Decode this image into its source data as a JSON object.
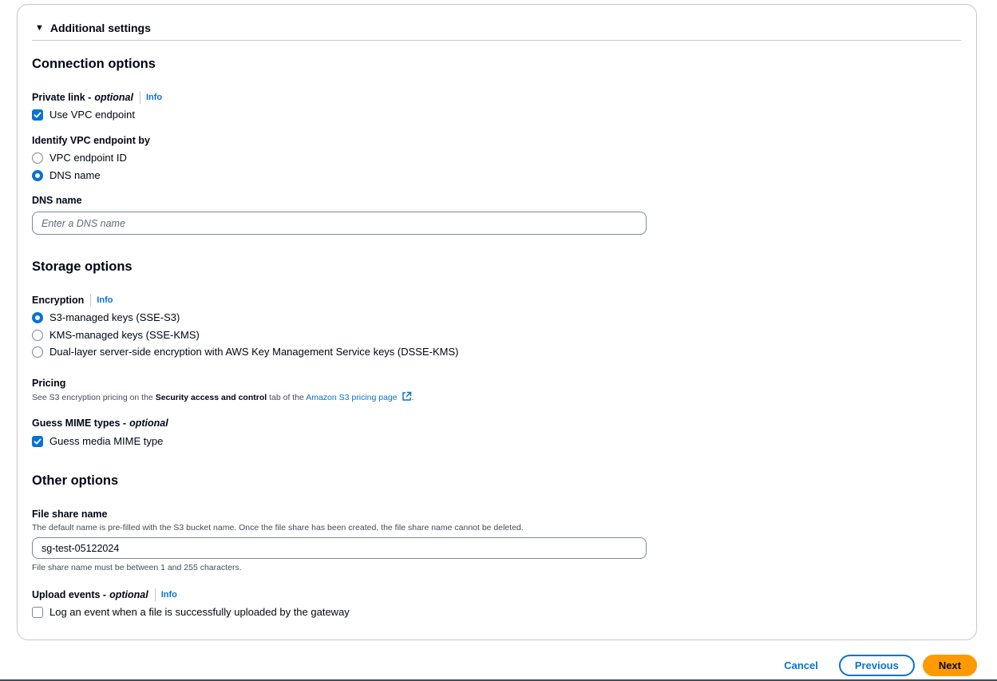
{
  "section": {
    "title": "Additional settings"
  },
  "connection": {
    "heading": "Connection options",
    "private_link_label": "Private link -",
    "private_link_optional": "optional",
    "private_link_info": "Info",
    "use_vpc_label": "Use VPC endpoint",
    "use_vpc_checked": true,
    "identify_label": "Identify VPC endpoint by",
    "identify_options": [
      {
        "label": "VPC endpoint ID",
        "selected": false
      },
      {
        "label": "DNS name",
        "selected": true
      }
    ],
    "dns_label": "DNS name",
    "dns_placeholder": "Enter a DNS name",
    "dns_value": ""
  },
  "storage": {
    "heading": "Storage options",
    "encryption_label": "Encryption",
    "encryption_info": "Info",
    "encryption_options": [
      {
        "label": "S3-managed keys (SSE-S3)",
        "selected": true
      },
      {
        "label": "KMS-managed keys (SSE-KMS)",
        "selected": false
      },
      {
        "label": "Dual-layer server-side encryption with AWS Key Management Service keys (DSSE-KMS)",
        "selected": false
      }
    ],
    "pricing_label": "Pricing",
    "pricing_desc_prefix": "See S3 encryption pricing on the ",
    "pricing_desc_bold": "Security access and control",
    "pricing_desc_mid": " tab of the ",
    "pricing_desc_link": "Amazon S3 pricing page",
    "pricing_desc_suffix": ".",
    "mime_label": "Guess MIME types -",
    "mime_optional": "optional",
    "mime_checkbox_label": "Guess media MIME type",
    "mime_checked": true
  },
  "other": {
    "heading": "Other options",
    "file_share_label": "File share name",
    "file_share_desc": "The default name is pre-filled with the S3 bucket name. Once the file share has been created, the file share name cannot be deleted.",
    "file_share_value": "sg-test-05122024",
    "file_share_constraint": "File share name must be between 1 and 255 characters.",
    "upload_label": "Upload events -",
    "upload_optional": "optional",
    "upload_info": "Info",
    "upload_checkbox_label": "Log an event when a file is successfully uploaded by the gateway",
    "upload_checked": false
  },
  "footer": {
    "cancel": "Cancel",
    "previous": "Previous",
    "next": "Next"
  },
  "colors": {
    "accent": "#0972d3",
    "primary_button": "#ff9900",
    "border": "#c6c6cd"
  }
}
